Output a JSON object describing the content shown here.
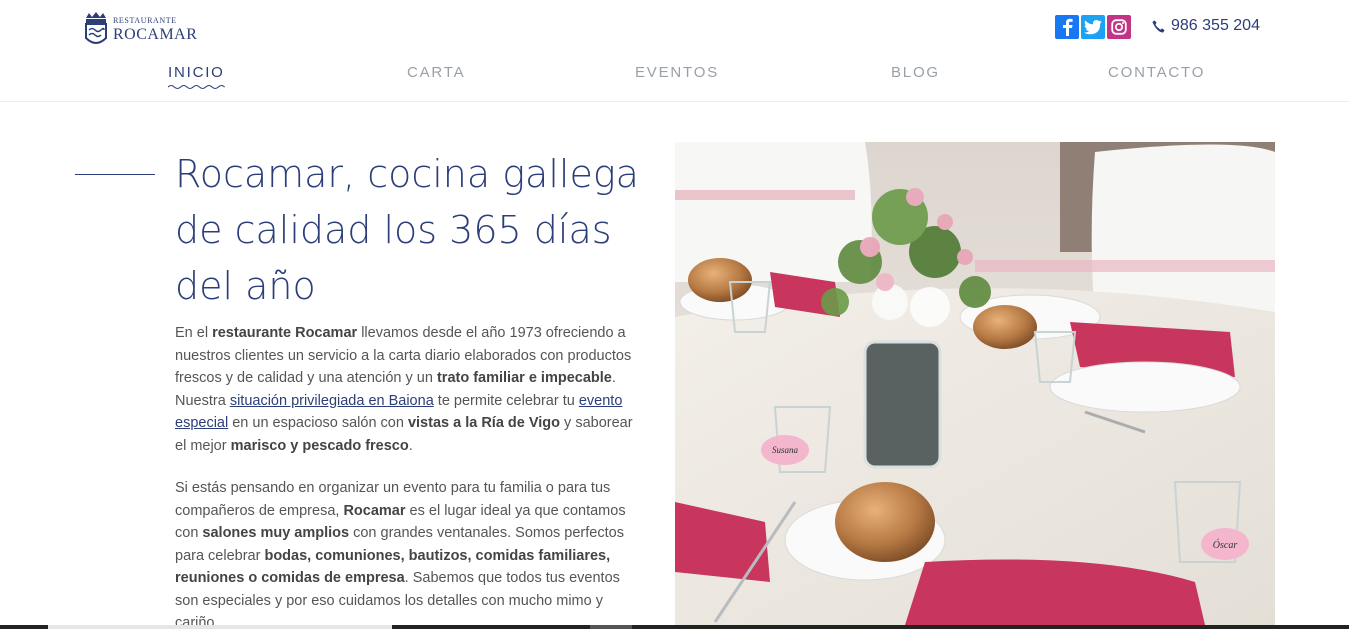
{
  "header": {
    "logo_small": "RESTAURANTE",
    "logo_big": "ROCAMAR",
    "social": [
      {
        "name": "facebook",
        "icon": "facebook-icon"
      },
      {
        "name": "twitter",
        "icon": "twitter-icon"
      },
      {
        "name": "instagram",
        "icon": "instagram-icon"
      }
    ],
    "phone": "986 355 204"
  },
  "nav": {
    "items": [
      "INICIO",
      "CARTA",
      "EVENTOS",
      "BLOG",
      "CONTACTO"
    ],
    "active": "INICIO"
  },
  "main": {
    "title": "Rocamar, cocina gallega de calidad los 365 días del año",
    "p1": {
      "t1": "En el ",
      "b1": "restaurante Rocamar",
      "t2": " llevamos desde el año 1973 ofreciendo a nuestros clientes un servicio a la carta diario elaborados con productos frescos y de calidad y una atención y un ",
      "b2": "trato familiar e impecable",
      "t3": ". Nuestra ",
      "link1": "situación privilegiada en Baiona",
      "t4": " te permite celebrar tu ",
      "link2": "evento especial",
      "t5": " en un espacioso salón con ",
      "b3": "vistas a la Ría de Vigo",
      "t6": " y saborear el mejor ",
      "b4": "marisco y pescado fresco",
      "t7": "."
    },
    "p2": {
      "t1": "Si estás pensando en organizar un evento para tu familia o para tus compañeros de empresa, ",
      "b1": "Rocamar",
      "t2": " es el lugar ideal ya que contamos con ",
      "b2": "salones muy amplios",
      "t3": " con grandes ventanales. Somos perfectos para celebrar ",
      "b3": "bodas, comuniones, bautizos, comidas familiares, reuniones o comidas de empresa",
      "t4": ". Sabemos que todos tus eventos son especiales y por eso cuidamos los detalles con mucho mimo y cariño."
    },
    "photo_tags": [
      "Susana",
      "Óscar"
    ]
  },
  "colors": {
    "brand": "#2c3e79",
    "nav_inactive": "#9aa0a8",
    "napkin": "#c8365e"
  }
}
